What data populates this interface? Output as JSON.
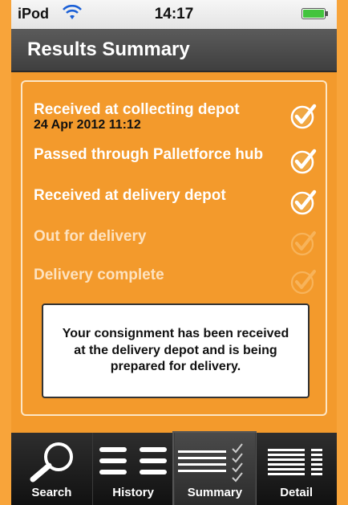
{
  "status_bar": {
    "carrier": "iPod",
    "time": "14:17",
    "icons": [
      "wifi-icon",
      "battery-icon"
    ]
  },
  "nav": {
    "title": "Results Summary"
  },
  "steps": [
    {
      "label": "Received at collecting depot",
      "date": "24 Apr 2012 11:12",
      "done": true,
      "icon": "check-icon"
    },
    {
      "label": "Passed through Palletforce hub",
      "date": "",
      "done": true,
      "icon": "check-icon"
    },
    {
      "label": "Received at delivery depot",
      "date": "",
      "done": true,
      "icon": "check-icon"
    },
    {
      "label": "Out for delivery",
      "date": "",
      "done": false,
      "icon": "check-icon"
    },
    {
      "label": "Delivery complete",
      "date": "",
      "done": false,
      "icon": "check-icon"
    }
  ],
  "message": "Your consignment has been received at the delivery depot and is being prepared for delivery.",
  "tabs": [
    {
      "label": "Search",
      "icon": "search-icon",
      "active": false
    },
    {
      "label": "History",
      "icon": "history-list-icon",
      "active": false
    },
    {
      "label": "Summary",
      "icon": "summary-checklist-icon",
      "active": true
    },
    {
      "label": "Detail",
      "icon": "detail-list-icon",
      "active": false
    }
  ],
  "colors": {
    "background": "#f39a2c",
    "navbar": "#4a4a4a",
    "check_active": "#ffffff",
    "check_inactive": "#f7b35a"
  }
}
